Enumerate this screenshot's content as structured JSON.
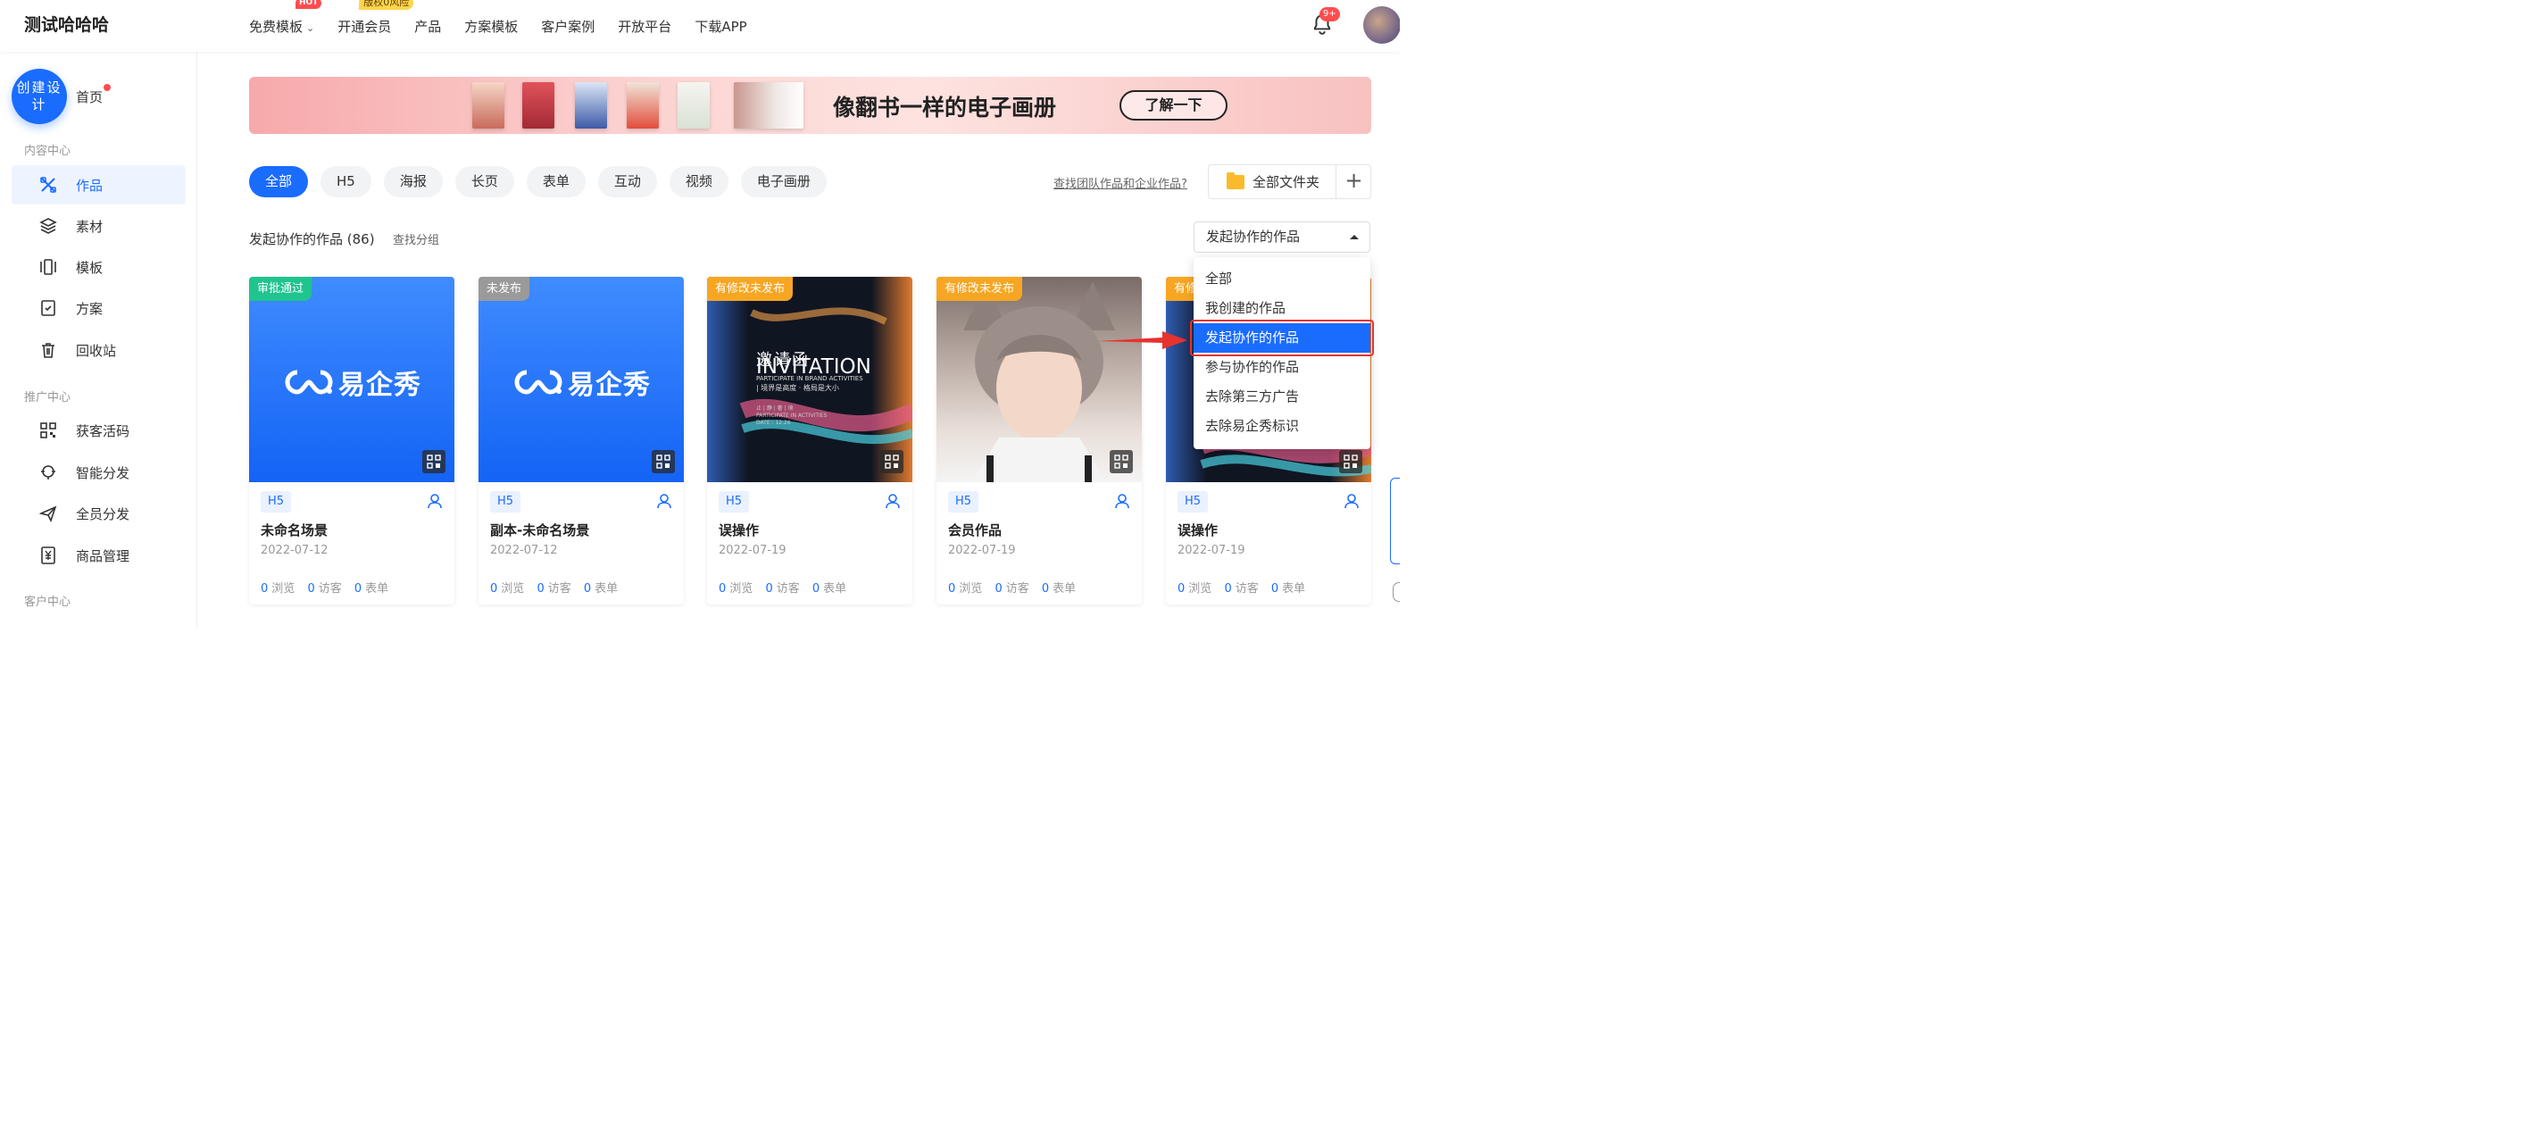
{
  "brand": "测试哈哈哈",
  "nav": {
    "items": [
      {
        "label": "免费模板",
        "badge": "HOT"
      },
      {
        "label": "开通会员",
        "badge": "版权0风险"
      },
      {
        "label": "产品"
      },
      {
        "label": "方案模板"
      },
      {
        "label": "客户案例"
      },
      {
        "label": "开放平台"
      },
      {
        "label": "下载APP"
      }
    ],
    "notifications": "9+"
  },
  "sidebar": {
    "create_label": "创建设计",
    "home_label": "首页",
    "sections": [
      "内容中心",
      "推广中心",
      "客户中心"
    ],
    "content_items": [
      {
        "label": "作品",
        "icon": "works-icon",
        "active": true
      },
      {
        "label": "素材",
        "icon": "layers-icon"
      },
      {
        "label": "模板",
        "icon": "template-icon"
      },
      {
        "label": "方案",
        "icon": "plan-icon"
      },
      {
        "label": "回收站",
        "icon": "trash-icon"
      }
    ],
    "promo_items": [
      {
        "label": "获客活码",
        "icon": "qrcode-icon"
      },
      {
        "label": "智能分发",
        "icon": "smart-distribute-icon"
      },
      {
        "label": "全员分发",
        "icon": "send-icon"
      },
      {
        "label": "商品管理",
        "icon": "yen-icon"
      }
    ]
  },
  "banner": {
    "headline": "像翻书一样的电子画册",
    "button": "了解一下"
  },
  "filters": {
    "tabs": [
      "全部",
      "H5",
      "海报",
      "长页",
      "表单",
      "互动",
      "视频",
      "电子画册"
    ],
    "active_index": 0,
    "team_link": "查找团队作品和企业作品?",
    "folder_label": "全部文件夹",
    "add_label": "+"
  },
  "list": {
    "title": "发起协作的作品 (86)",
    "find_group": "查找分组",
    "select_value": "发起协作的作品"
  },
  "dropdown": {
    "options": [
      "全部",
      "我创建的作品",
      "发起协作的作品",
      "参与协作的作品",
      "去除第三方广告",
      "去除易企秀标识"
    ],
    "selected_index": 2
  },
  "cards": [
    {
      "status": "审批通过",
      "status_color": "#1fc48e",
      "cover": "blue",
      "logo": "易企秀",
      "type": "H5",
      "title": "未命名场景",
      "date": "2022-07-12",
      "views": "0",
      "views_label": "浏览",
      "visitors": "0",
      "visitors_label": "访客",
      "forms": "0",
      "forms_label": "表单"
    },
    {
      "status": "未发布",
      "status_color": "#9a9a9a",
      "cover": "blue",
      "logo": "易企秀",
      "type": "H5",
      "title": "副本-未命名场景",
      "date": "2022-07-12",
      "views": "0",
      "views_label": "浏览",
      "visitors": "0",
      "visitors_label": "访客",
      "forms": "0",
      "forms_label": "表单"
    },
    {
      "status": "有修改未发布",
      "status_color": "#f6a623",
      "cover": "invitation",
      "type": "H5",
      "title": "误操作",
      "date": "2022-07-19",
      "views": "0",
      "views_label": "浏览",
      "visitors": "0",
      "visitors_label": "访客",
      "forms": "0",
      "forms_label": "表单",
      "invitation": {
        "cn": "邀请函",
        "en": "INVITATION",
        "sub1": "PARTICIPATE IN BRAND ACTIVITIES",
        "sub2": "| 境界是高度 · 格局是大小",
        "sub3": "止 | 静 | 奢 | 境",
        "sub4": "PARTICIPATE IN ACTIVITIES",
        "sub5": "DATE : 12.26"
      }
    },
    {
      "status": "有修改未发布",
      "status_color": "#f6a623",
      "cover": "person",
      "type": "H5",
      "title": "会员作品",
      "date": "2022-07-19",
      "views": "0",
      "views_label": "浏览",
      "visitors": "0",
      "visitors_label": "访客",
      "forms": "0",
      "forms_label": "表单"
    },
    {
      "status": "有修改未发布",
      "status_color": "#f6a623",
      "cover": "invitation",
      "type": "H5",
      "title": "误操作",
      "date": "2022-07-19",
      "views": "0",
      "views_label": "浏览",
      "visitors": "0",
      "visitors_label": "访客",
      "forms": "0",
      "forms_label": "表单"
    }
  ],
  "colors": {
    "accent": "#1a6cff",
    "highlight": "#e8322d"
  }
}
